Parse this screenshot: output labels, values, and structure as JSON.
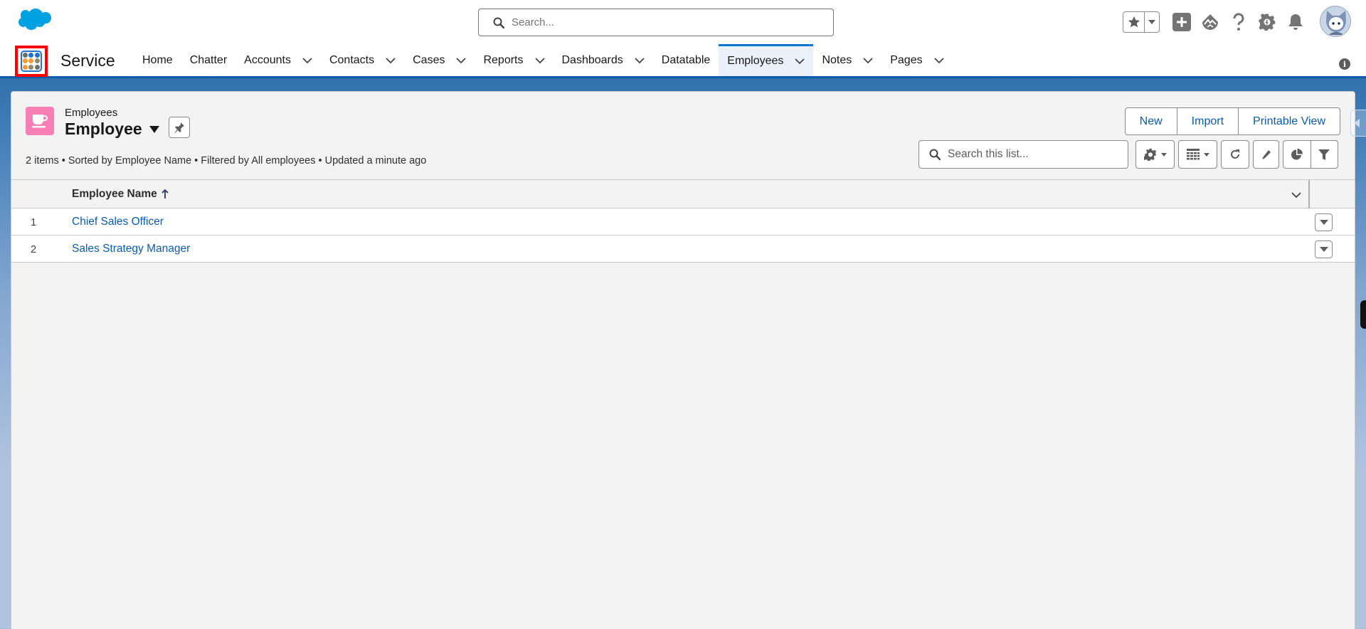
{
  "global_header": {
    "logo": "salesforce-cloud-logo",
    "search": {
      "placeholder": "Search...",
      "value": ""
    },
    "actions": [
      {
        "icon": "star-icon",
        "label": "Favorites"
      },
      {
        "icon": "chevron-down-icon",
        "label": "Favorites list"
      },
      {
        "icon": "add-icon",
        "label": "Global Actions"
      },
      {
        "icon": "trailhead-icon",
        "label": "Guidance Center"
      },
      {
        "icon": "help-icon",
        "label": "Help"
      },
      {
        "icon": "gear-icon",
        "label": "Setup"
      },
      {
        "icon": "bell-icon",
        "label": "Notifications"
      },
      {
        "icon": "avatar-icon",
        "label": "View profile"
      }
    ]
  },
  "nav": {
    "app_name": "Service",
    "items": [
      {
        "label": "Home",
        "dropdown": false,
        "active": false
      },
      {
        "label": "Chatter",
        "dropdown": false,
        "active": false
      },
      {
        "label": "Accounts",
        "dropdown": true,
        "active": false
      },
      {
        "label": "Contacts",
        "dropdown": true,
        "active": false
      },
      {
        "label": "Cases",
        "dropdown": true,
        "active": false
      },
      {
        "label": "Reports",
        "dropdown": true,
        "active": false
      },
      {
        "label": "Dashboards",
        "dropdown": true,
        "active": false
      },
      {
        "label": "Datatable",
        "dropdown": false,
        "active": false
      },
      {
        "label": "Employees",
        "dropdown": true,
        "active": true
      },
      {
        "label": "Notes",
        "dropdown": true,
        "active": false
      },
      {
        "label": "Pages",
        "dropdown": true,
        "active": false
      }
    ]
  },
  "list_view": {
    "object_label": "Employees",
    "title": "Employee",
    "meta": "2 items • Sorted by Employee Name • Filtered by All employees • Updated a minute ago",
    "buttons": {
      "new": "New",
      "import": "Import",
      "printable": "Printable View"
    },
    "search": {
      "placeholder": "Search this list...",
      "value": ""
    },
    "toolbar": [
      "list-view-controls",
      "display-as-table",
      "refresh",
      "inline-edit",
      "charts",
      "filters"
    ],
    "columns": [
      {
        "label": "Employee Name",
        "sort": "ascending"
      }
    ],
    "rows": [
      {
        "num": "1",
        "name": "Chief Sales Officer"
      },
      {
        "num": "2",
        "name": "Sales Strategy Manager"
      }
    ]
  },
  "colors": {
    "brand_blue": "#0b5cab",
    "nav_active_bg": "#eaf1fb",
    "object_icon": "#f77fb4",
    "launcher_highlight": "#ff0000"
  }
}
